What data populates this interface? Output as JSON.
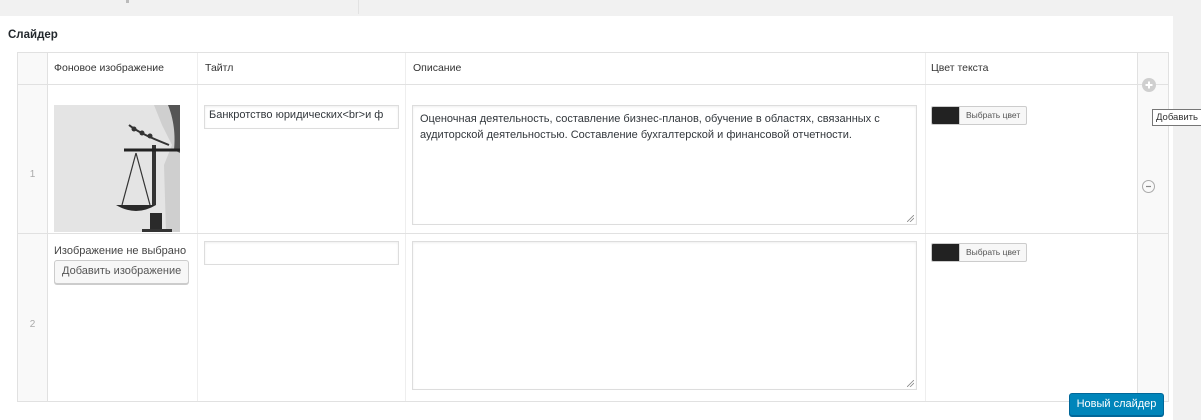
{
  "section": {
    "title": "Слайдер"
  },
  "table": {
    "headers": [
      "Фоновое изображение",
      "Тайтл",
      "Описание",
      "Цвет текста"
    ]
  },
  "rows": [
    {
      "number": "1",
      "title_value": "Банкротство юридических<br>и ф",
      "description": "Оценочная деятельность, составление бизнес-планов, обучение в областях, связанных с аудиторской деятельностью. Составление бухгалтерской и финансовой отчетности.",
      "color_button_label": "Выбрать цвет",
      "color_value": "#222222"
    },
    {
      "number": "2",
      "no_image_text": "Изображение не выбрано",
      "add_image_label": "Добавить изображение",
      "title_value": "",
      "description": "",
      "color_button_label": "Выбрать цвет",
      "color_value": "#222222"
    }
  ],
  "row_actions": {
    "add_icon": "plus-circle-icon",
    "remove_icon": "minus-circle-icon",
    "tooltip": "Добавить"
  },
  "footer": {
    "new_slider_label": "Новый слайдер"
  },
  "colors": {
    "primary_button": "#0085ba",
    "panel_background": "#ffffff",
    "page_background": "#f1f1f1"
  }
}
